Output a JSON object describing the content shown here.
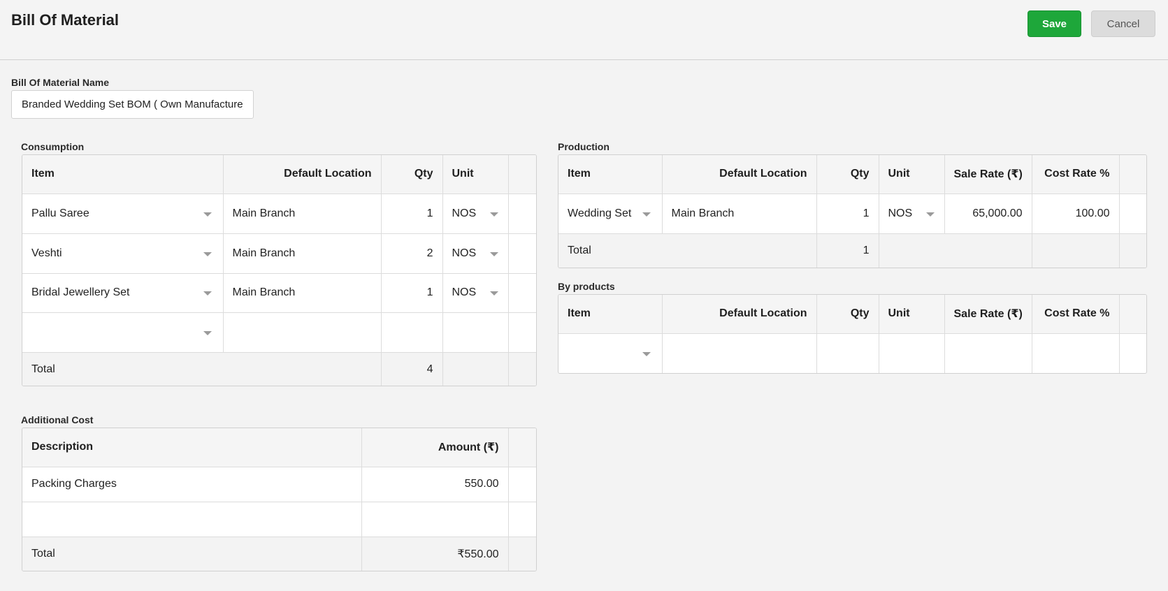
{
  "header": {
    "title": "Bill Of Material",
    "save_label": "Save",
    "cancel_label": "Cancel"
  },
  "bom_name": {
    "label": "Bill Of Material Name",
    "value": "Branded Wedding Set BOM ( Own Manufacture)"
  },
  "consumption": {
    "label": "Consumption",
    "columns": {
      "item": "Item",
      "location": "Default Location",
      "qty": "Qty",
      "unit": "Unit"
    },
    "rows": [
      {
        "item": "Pallu Saree",
        "location": "Main Branch",
        "qty": "1",
        "unit": "NOS"
      },
      {
        "item": "Veshti",
        "location": "Main Branch",
        "qty": "2",
        "unit": "NOS"
      },
      {
        "item": "Bridal Jewellery Set",
        "location": "Main Branch",
        "qty": "1",
        "unit": "NOS"
      }
    ],
    "total_label": "Total",
    "total_qty": "4"
  },
  "production": {
    "label": "Production",
    "columns": {
      "item": "Item",
      "location": "Default Location",
      "qty": "Qty",
      "unit": "Unit",
      "sale_rate": "Sale Rate (₹)",
      "cost_rate": "Cost Rate %"
    },
    "rows": [
      {
        "item": "Wedding Set",
        "location": "Main Branch",
        "qty": "1",
        "unit": "NOS",
        "sale_rate": "65,000.00",
        "cost_rate": "100.00"
      }
    ],
    "total_label": "Total",
    "total_qty": "1"
  },
  "by_products": {
    "label": "By products",
    "columns": {
      "item": "Item",
      "location": "Default Location",
      "qty": "Qty",
      "unit": "Unit",
      "sale_rate": "Sale Rate (₹)",
      "cost_rate": "Cost Rate %"
    }
  },
  "additional_cost": {
    "label": "Additional Cost",
    "columns": {
      "description": "Description",
      "amount": "Amount (₹)"
    },
    "rows": [
      {
        "description": "Packing Charges",
        "amount": "550.00"
      }
    ],
    "total_label": "Total",
    "total_amount": "₹550.00"
  },
  "icons": {
    "dropdown": "chevron-down-icon"
  }
}
